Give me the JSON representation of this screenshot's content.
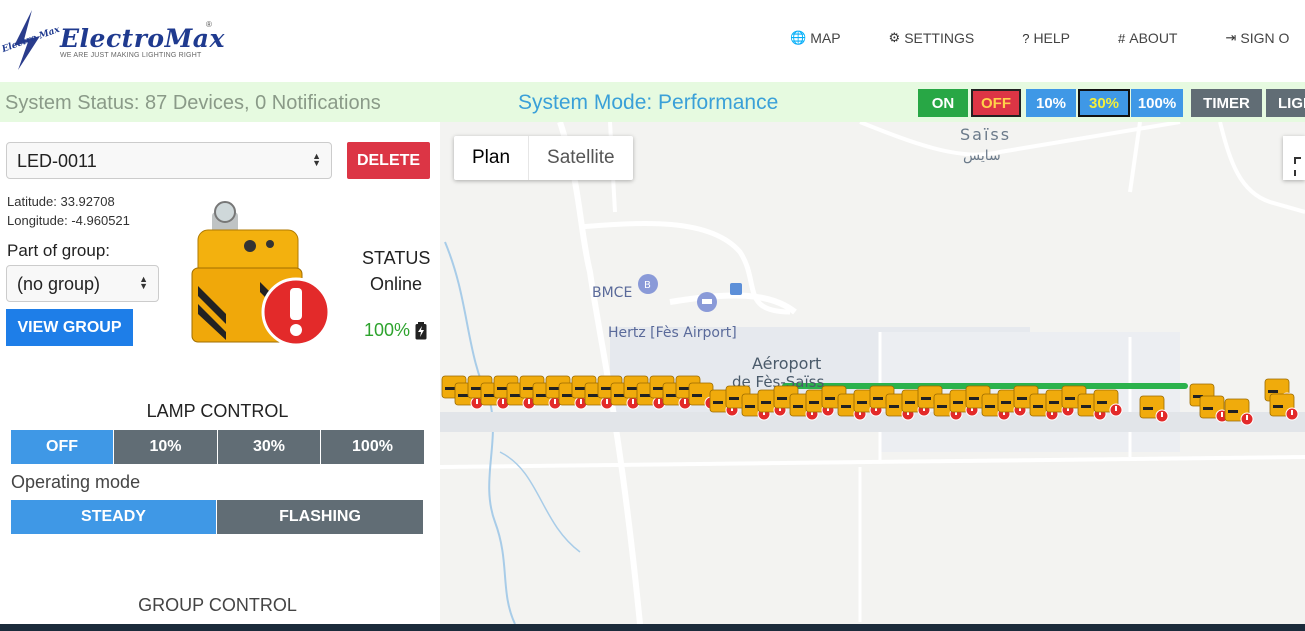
{
  "header": {
    "logo_side_text": "Electro Max",
    "brand": "ElectroMax",
    "registered": "®",
    "tagline": "WE ARE JUST MAKING LIGHTING RIGHT",
    "nav": [
      {
        "icon": "globe-icon",
        "glyph": "🌐",
        "label": "MAP"
      },
      {
        "icon": "gears-icon",
        "glyph": "⚙",
        "label": "SETTINGS"
      },
      {
        "icon": "question-icon",
        "glyph": "?",
        "label": "HELP"
      },
      {
        "icon": "hash-icon",
        "glyph": "#",
        "label": "ABOUT"
      },
      {
        "icon": "sign-out-icon",
        "glyph": "⇥",
        "label": "SIGN O"
      }
    ]
  },
  "status_bar": {
    "system_status": "System Status: 87 Devices, 0 Notifications",
    "system_mode": "System Mode: Performance",
    "buttons": [
      {
        "label": "ON",
        "bg": "#28a745",
        "fg": "#ffffff"
      },
      {
        "label": "OFF",
        "bg": "#dc3545",
        "fg": "#ffd24a"
      },
      {
        "label": "10%",
        "bg": "#3f98e6",
        "fg": "#ffffff"
      },
      {
        "label": "30%",
        "bg": "#3f98e6",
        "fg": "#f4ee3a"
      },
      {
        "label": "100%",
        "bg": "#3f98e6",
        "fg": "#ffffff"
      },
      {
        "label": "TIMER",
        "bg": "#616d75",
        "fg": "#ffffff"
      },
      {
        "label": "LIGH",
        "bg": "#616d75",
        "fg": "#ffffff"
      }
    ]
  },
  "device": {
    "selected": "LED-0011",
    "delete_label": "DELETE",
    "latitude": "Latitude: 33.92708",
    "longitude": "Longitude: -4.960521",
    "group_label": "Part of group:",
    "group_value": "(no group)",
    "view_group_label": "VIEW GROUP",
    "status_label": "STATUS",
    "status_value": "Online",
    "battery": "100%",
    "alert_icon": "exclamation-alert-icon"
  },
  "lamp_control": {
    "title": "LAMP CONTROL",
    "levels": [
      {
        "label": "OFF",
        "active": true
      },
      {
        "label": "10%",
        "active": false
      },
      {
        "label": "30%",
        "active": false
      },
      {
        "label": "100%",
        "active": false
      }
    ],
    "operating_mode_label": "Operating mode",
    "modes": [
      {
        "label": "STEADY",
        "active": true
      },
      {
        "label": "FLASHING",
        "active": false
      }
    ]
  },
  "group_control": {
    "title": "GROUP CONTROL"
  },
  "map": {
    "plan_label": "Plan",
    "satellite_label": "Satellite",
    "labels": {
      "town": "Saïss",
      "town_ar": "سايس",
      "bank": "BMCE",
      "rental": "Hertz [Fès Airport]",
      "airport": "Aéroport",
      "airport2": "de Fès-Saïss"
    },
    "colors": {
      "active_runway_line": "#2bb24c",
      "accent_blue": "#3f98e6",
      "danger": "#dc3545"
    }
  }
}
